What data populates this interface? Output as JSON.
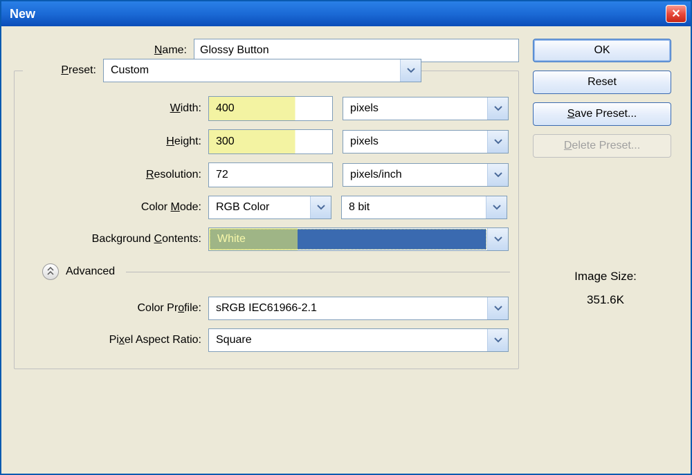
{
  "title": "New",
  "labels": {
    "name": "Name:",
    "preset": "Preset:",
    "width": "Width:",
    "height": "Height:",
    "resolution": "Resolution:",
    "colorMode": "Color Mode:",
    "backgroundContents": "Background Contents:",
    "advanced": "Advanced",
    "colorProfile": "Color Profile:",
    "pixelAspect": "Pixel Aspect Ratio:",
    "imageSizeLabel": "Image Size:"
  },
  "values": {
    "name": "Glossy Button",
    "preset": "Custom",
    "width": "400",
    "height": "300",
    "resolution": "72",
    "widthUnit": "pixels",
    "heightUnit": "pixels",
    "resolutionUnit": "pixels/inch",
    "colorMode": "RGB Color",
    "bitDepth": "8 bit",
    "backgroundContents": "White",
    "colorProfile": "sRGB IEC61966-2.1",
    "pixelAspect": "Square",
    "imageSize": "351.6K"
  },
  "buttons": {
    "ok": "OK",
    "reset": "Reset",
    "savePreset": "Save Preset...",
    "deletePreset": "Delete Preset..."
  }
}
